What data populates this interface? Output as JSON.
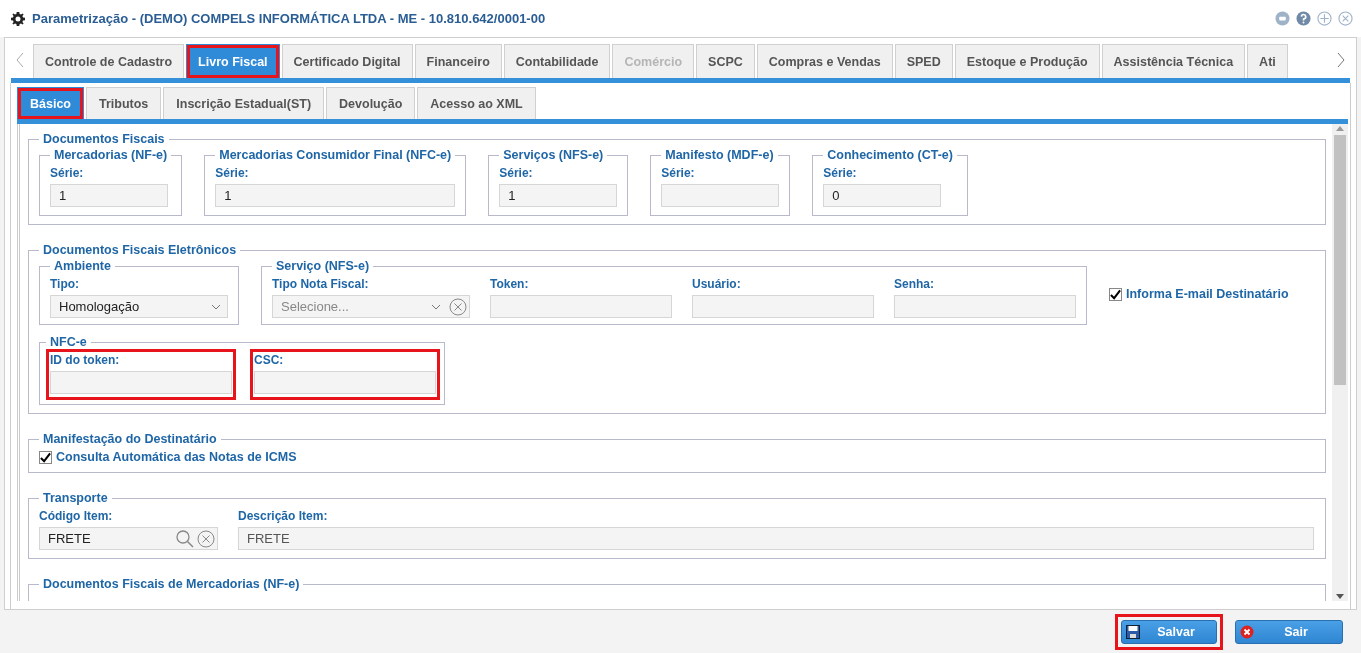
{
  "window": {
    "title": "Parametrização - (DEMO) COMPELS INFORMÁTICA LTDA - ME - 10.810.642/0001-00"
  },
  "tabs": [
    {
      "label": "Controle de Cadastro",
      "selected": false,
      "disabled": false,
      "highlighted": false
    },
    {
      "label": "Livro Fiscal",
      "selected": true,
      "disabled": false,
      "highlighted": true
    },
    {
      "label": "Certificado Digital",
      "selected": false,
      "disabled": false,
      "highlighted": false
    },
    {
      "label": "Financeiro",
      "selected": false,
      "disabled": false,
      "highlighted": false
    },
    {
      "label": "Contabilidade",
      "selected": false,
      "disabled": false,
      "highlighted": false
    },
    {
      "label": "Comércio",
      "selected": false,
      "disabled": true,
      "highlighted": false
    },
    {
      "label": "SCPC",
      "selected": false,
      "disabled": false,
      "highlighted": false
    },
    {
      "label": "Compras e Vendas",
      "selected": false,
      "disabled": false,
      "highlighted": false
    },
    {
      "label": "SPED",
      "selected": false,
      "disabled": false,
      "highlighted": false
    },
    {
      "label": "Estoque e Produção",
      "selected": false,
      "disabled": false,
      "highlighted": false
    },
    {
      "label": "Assistência Técnica",
      "selected": false,
      "disabled": false,
      "highlighted": false
    },
    {
      "label": "Ati",
      "selected": false,
      "disabled": false,
      "highlighted": false
    }
  ],
  "subtabs": [
    {
      "label": "Básico",
      "selected": true,
      "highlighted": true
    },
    {
      "label": "Tributos",
      "selected": false,
      "highlighted": false
    },
    {
      "label": "Inscrição Estadual(ST)",
      "selected": false,
      "highlighted": false
    },
    {
      "label": "Devolução",
      "selected": false,
      "highlighted": false
    },
    {
      "label": "Acesso ao XML",
      "selected": false,
      "highlighted": false
    }
  ],
  "documentos_fiscais": {
    "title": "Documentos Fiscais",
    "groups": [
      {
        "title": "Mercadorias (NF-e)",
        "label": "Série:",
        "value": "1"
      },
      {
        "title": "Mercadorias Consumidor Final (NFC-e)",
        "label": "Série:",
        "value": "1"
      },
      {
        "title": "Serviços (NFS-e)",
        "label": "Série:",
        "value": "1"
      },
      {
        "title": "Manifesto (MDF-e)",
        "label": "Série:"
      },
      {
        "title": "Conhecimento (CT-e)",
        "label": "Série:",
        "value": "0"
      }
    ]
  },
  "documentos_eletronicos": {
    "title": "Documentos Fiscais Eletrônicos",
    "ambiente": {
      "title": "Ambiente",
      "label": "Tipo:",
      "value": "Homologação"
    },
    "servico": {
      "title": "Serviço (NFS-e)",
      "tipo_label": "Tipo Nota Fiscal:",
      "tipo_placeholder": "Selecione...",
      "fields": [
        {
          "label": "Token:"
        },
        {
          "label": "Usuário:"
        },
        {
          "label": "Senha:"
        }
      ]
    },
    "informa_email": {
      "label": "Informa E-mail Destinatário",
      "checked": true
    },
    "nfce": {
      "title": "NFC-e",
      "fields": [
        {
          "label": "ID do token:",
          "highlighted": true
        },
        {
          "label": "CSC:",
          "highlighted": true
        }
      ]
    }
  },
  "manifestacao": {
    "title": "Manifestação do Destinatário",
    "checkbox": {
      "label": "Consulta Automática das Notas de ICMS",
      "checked": true
    }
  },
  "transporte": {
    "title": "Transporte",
    "codigo_label": "Código Item:",
    "codigo_value": "FRETE",
    "descricao_label": "Descrição Item:",
    "descricao_value": "FRETE"
  },
  "mercadorias": {
    "title": "Documentos Fiscais de Mercadorias (NF-e)"
  },
  "buttons": [
    {
      "label": "Salvar",
      "kind": "save",
      "highlighted": true
    },
    {
      "label": "Sair",
      "kind": "exit",
      "highlighted": false
    }
  ]
}
